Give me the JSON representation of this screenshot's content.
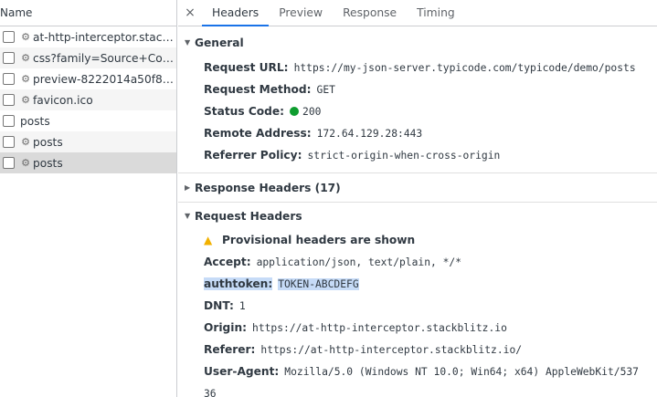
{
  "requests": {
    "header": "Name",
    "items": [
      {
        "name": "at-http-interceptor.stack…",
        "icon": "gear-icon"
      },
      {
        "name": "css?family=Source+Cod…",
        "icon": "gear-icon"
      },
      {
        "name": "preview-8222014a50f85…",
        "icon": "gear-icon"
      },
      {
        "name": "favicon.ico",
        "icon": "gear-icon"
      },
      {
        "name": "posts",
        "icon": ""
      },
      {
        "name": "posts",
        "icon": "gear-icon"
      },
      {
        "name": "posts",
        "icon": "gear-icon"
      }
    ],
    "selected_index": 6
  },
  "tabs": {
    "close": "×",
    "items": [
      "Headers",
      "Preview",
      "Response",
      "Timing"
    ],
    "active": "Headers"
  },
  "general": {
    "title": "General",
    "request_url_label": "Request URL:",
    "request_url": "https://my-json-server.typicode.com/typicode/demo/posts",
    "method_label": "Request Method:",
    "method": "GET",
    "status_label": "Status Code:",
    "status": "200",
    "status_color": "#0e9d2f",
    "remote_label": "Remote Address:",
    "remote": "172.64.129.28:443",
    "referrer_policy_label": "Referrer Policy:",
    "referrer_policy": "strict-origin-when-cross-origin"
  },
  "response_headers": {
    "title": "Response Headers (17)"
  },
  "request_headers": {
    "title": "Request Headers",
    "warning": "Provisional headers are shown",
    "accept_label": "Accept:",
    "accept": "application/json, text/plain, */*",
    "authtoken_label": "authtoken:",
    "authtoken": "TOKEN-ABCDEFG",
    "dnt_label": "DNT:",
    "dnt": "1",
    "origin_label": "Origin:",
    "origin": "https://at-http-interceptor.stackblitz.io",
    "referer_label": "Referer:",
    "referer": "https://at-http-interceptor.stackblitz.io/",
    "ua_label": "User-Agent:",
    "ua": "Mozilla/5.0 (Windows NT 10.0; Win64; x64) AppleWebKit/537",
    "ua_cont": "36"
  }
}
